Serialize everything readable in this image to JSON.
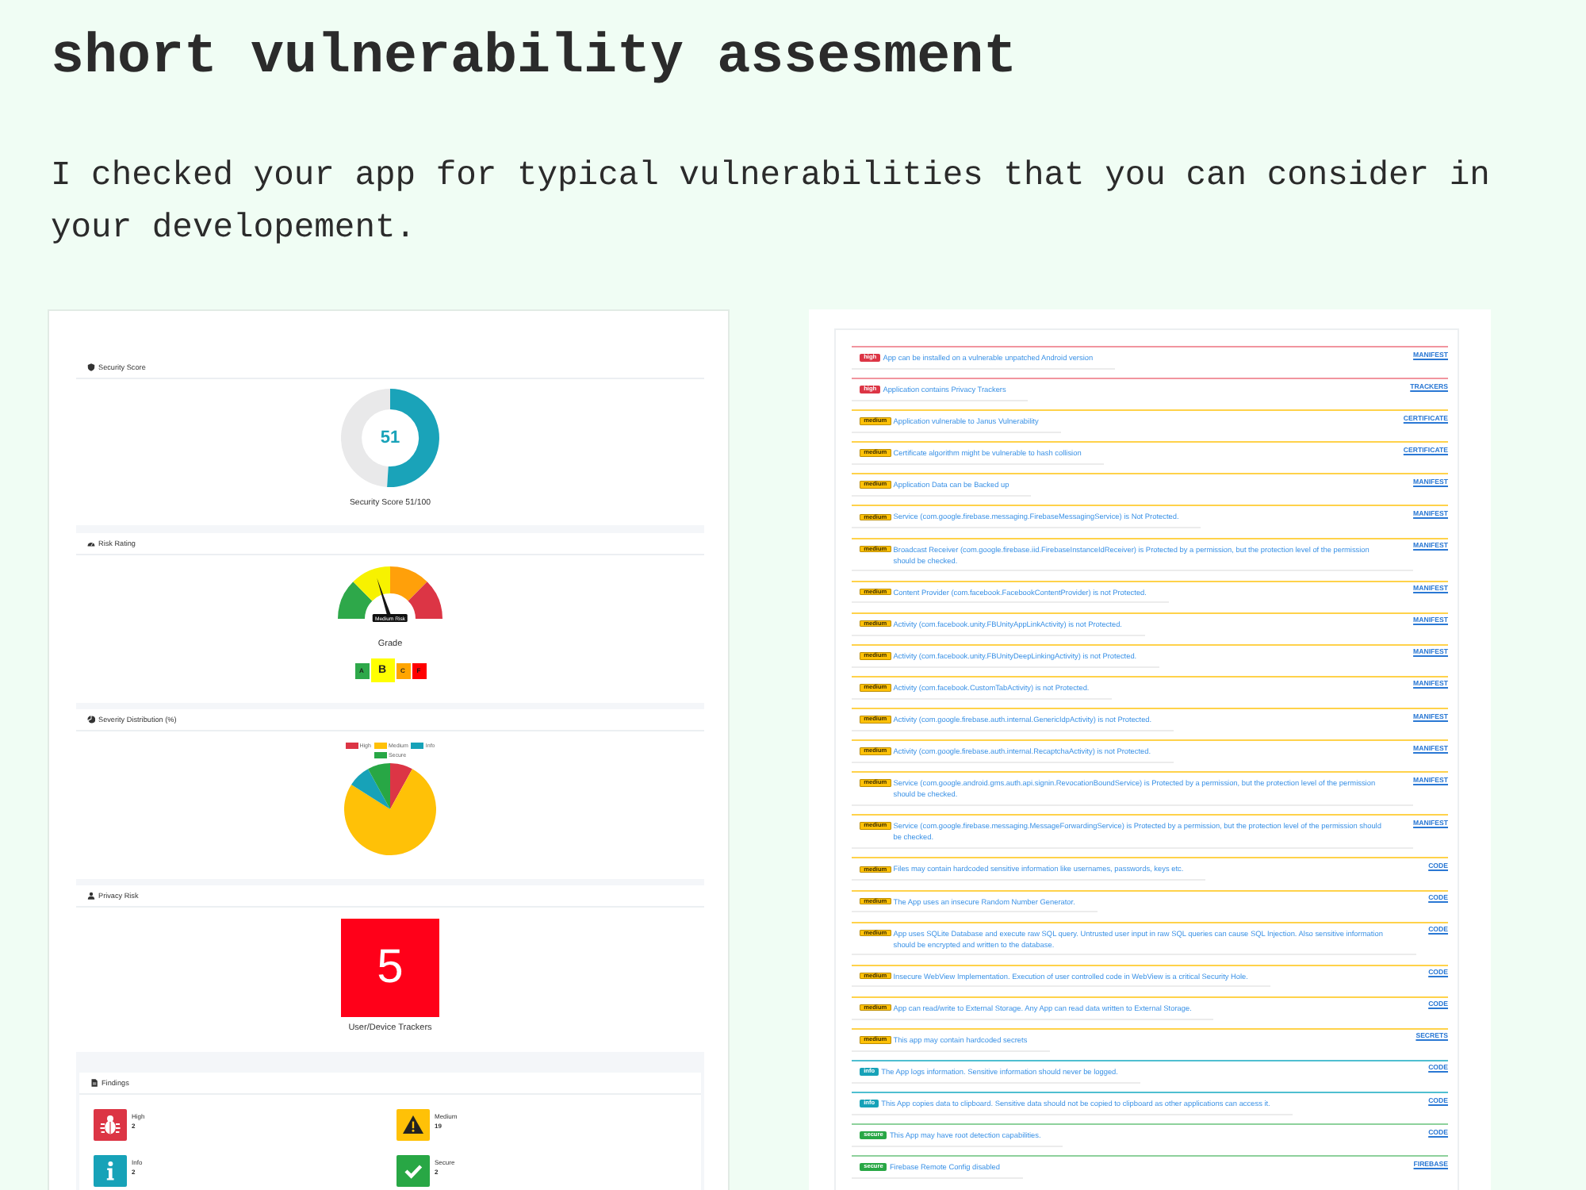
{
  "page": {
    "title": "short vulnerability assesment",
    "intro": "I checked your app for typical vulnerabilities that you can consider in your developement."
  },
  "dashboard": {
    "security_score": {
      "title": "Security Score",
      "value": "51",
      "level": 0.51,
      "caption": "Security Score 51/100"
    },
    "risk_rating": {
      "title": "Risk Rating",
      "gauge_label": "Medium Risk",
      "level": 0.4,
      "grade_title": "Grade",
      "grades": [
        {
          "label": "A",
          "color": "#2ea84a",
          "selected": false
        },
        {
          "label": "B",
          "color": "#ffff00",
          "selected": true
        },
        {
          "label": "C",
          "color": "#ffa500",
          "selected": false
        },
        {
          "label": "F",
          "color": "#ff0000",
          "selected": false
        }
      ]
    },
    "severity_distribution": {
      "title": "Severity Distribution (%)",
      "legend": [
        {
          "label": "High",
          "color": "#dc3545"
        },
        {
          "label": "Medium",
          "color": "#ffc107"
        },
        {
          "label": "Info",
          "color": "#17a2b8"
        },
        {
          "label": "Secure",
          "color": "#28a745"
        }
      ]
    },
    "privacy_risk": {
      "title": "Privacy Risk",
      "value": "5",
      "caption": "User/Device Trackers"
    },
    "findings": {
      "title": "Findings",
      "items": [
        {
          "kind": "high",
          "label": "High",
          "count": "2"
        },
        {
          "kind": "medium",
          "label": "Medium",
          "count": "19"
        },
        {
          "kind": "info",
          "label": "Info",
          "count": "2"
        },
        {
          "kind": "secure",
          "label": "Secure",
          "count": "2"
        }
      ]
    }
  },
  "issues": [
    {
      "kind": "high",
      "badge": "high",
      "text": "App can be installed on a vulnerable unpatched Android version",
      "section": "MANIFEST"
    },
    {
      "kind": "high",
      "badge": "high",
      "text": "Application contains Privacy Trackers",
      "section": "TRACKERS"
    },
    {
      "kind": "medium",
      "badge": "medium",
      "text": "Application vulnerable to Janus Vulnerability",
      "section": "CERTIFICATE"
    },
    {
      "kind": "medium",
      "badge": "medium",
      "text": "Certificate algorithm might be vulnerable to hash collision",
      "section": "CERTIFICATE"
    },
    {
      "kind": "medium",
      "badge": "medium",
      "text": "Application Data can be Backed up",
      "section": "MANIFEST"
    },
    {
      "kind": "medium",
      "badge": "medium",
      "text": "Service (com.google.firebase.messaging.FirebaseMessagingService) is Not Protected.",
      "section": "MANIFEST"
    },
    {
      "kind": "medium",
      "badge": "medium",
      "text": "Broadcast Receiver (com.google.firebase.iid.FirebaseInstanceIdReceiver) is Protected by a permission, but the protection level of the permission should be checked.",
      "section": "MANIFEST"
    },
    {
      "kind": "medium",
      "badge": "medium",
      "text": "Content Provider (com.facebook.FacebookContentProvider) is not Protected.",
      "section": "MANIFEST"
    },
    {
      "kind": "medium",
      "badge": "medium",
      "text": "Activity (com.facebook.unity.FBUnityAppLinkActivity) is not Protected.",
      "section": "MANIFEST"
    },
    {
      "kind": "medium",
      "badge": "medium",
      "text": "Activity (com.facebook.unity.FBUnityDeepLinkingActivity) is not Protected.",
      "section": "MANIFEST"
    },
    {
      "kind": "medium",
      "badge": "medium",
      "text": "Activity (com.facebook.CustomTabActivity) is not Protected.",
      "section": "MANIFEST"
    },
    {
      "kind": "medium",
      "badge": "medium",
      "text": "Activity (com.google.firebase.auth.internal.GenericIdpActivity) is not Protected.",
      "section": "MANIFEST"
    },
    {
      "kind": "medium",
      "badge": "medium",
      "text": "Activity (com.google.firebase.auth.internal.RecaptchaActivity) is not Protected.",
      "section": "MANIFEST"
    },
    {
      "kind": "medium",
      "badge": "medium",
      "text": "Service (com.google.android.gms.auth.api.signin.RevocationBoundService) is Protected by a permission, but the protection level of the permission should be checked.",
      "section": "MANIFEST"
    },
    {
      "kind": "medium",
      "badge": "medium",
      "text": "Service (com.google.firebase.messaging.MessageForwardingService) is Protected by a permission, but the protection level of the permission should be checked.",
      "section": "MANIFEST"
    },
    {
      "kind": "medium",
      "badge": "medium",
      "text": "Files may contain hardcoded sensitive information like usernames, passwords, keys etc.",
      "section": "CODE"
    },
    {
      "kind": "medium",
      "badge": "medium",
      "text": "The App uses an insecure Random Number Generator.",
      "section": "CODE"
    },
    {
      "kind": "medium",
      "badge": "medium",
      "text": "App uses SQLite Database and execute raw SQL query. Untrusted user input in raw SQL queries can cause SQL Injection. Also sensitive information should be encrypted and written to the database.",
      "section": "CODE"
    },
    {
      "kind": "medium",
      "badge": "medium",
      "text": "Insecure WebView Implementation. Execution of user controlled code in WebView is a critical Security Hole.",
      "section": "CODE"
    },
    {
      "kind": "medium",
      "badge": "medium",
      "text": "App can read/write to External Storage. Any App can read data written to External Storage.",
      "section": "CODE"
    },
    {
      "kind": "medium",
      "badge": "medium",
      "text": "This app may contain hardcoded secrets",
      "section": "SECRETS"
    },
    {
      "kind": "info",
      "badge": "info",
      "text": "The App logs information. Sensitive information should never be logged.",
      "section": "CODE"
    },
    {
      "kind": "info",
      "badge": "info",
      "text": "This App copies data to clipboard. Sensitive data should not be copied to clipboard as other applications can access it.",
      "section": "CODE"
    },
    {
      "kind": "secure",
      "badge": "secure",
      "text": "This App may have root detection capabilities.",
      "section": "CODE"
    },
    {
      "kind": "secure",
      "badge": "secure",
      "text": "Firebase Remote Config disabled",
      "section": "FIREBASE"
    }
  ]
}
